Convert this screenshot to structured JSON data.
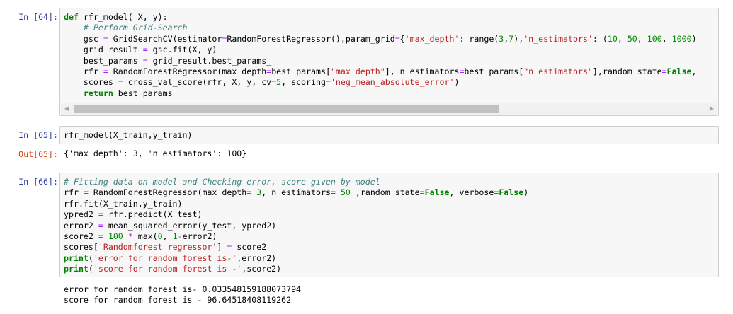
{
  "cells": [
    {
      "prompt": "In [64]:",
      "lines": [
        [
          {
            "t": "k",
            "v": "def"
          },
          {
            "t": "",
            "v": " rfr_model( X, y):"
          }
        ],
        [
          {
            "t": "",
            "v": "    "
          },
          {
            "t": "c",
            "v": "# Perform Grid-Search"
          }
        ],
        [
          {
            "t": "",
            "v": "    gsc "
          },
          {
            "t": "o",
            "v": "="
          },
          {
            "t": "",
            "v": " GridSearchCV(estimator"
          },
          {
            "t": "o",
            "v": "="
          },
          {
            "t": "",
            "v": "RandomForestRegressor(),param_grid"
          },
          {
            "t": "o",
            "v": "="
          },
          {
            "t": "",
            "v": "{"
          },
          {
            "t": "s",
            "v": "'max_depth'"
          },
          {
            "t": "",
            "v": ": range("
          },
          {
            "t": "n",
            "v": "3"
          },
          {
            "t": "",
            "v": ","
          },
          {
            "t": "n",
            "v": "7"
          },
          {
            "t": "",
            "v": "),"
          },
          {
            "t": "s",
            "v": "'n_estimators'"
          },
          {
            "t": "",
            "v": ": ("
          },
          {
            "t": "n",
            "v": "10"
          },
          {
            "t": "",
            "v": ", "
          },
          {
            "t": "n",
            "v": "50"
          },
          {
            "t": "",
            "v": ", "
          },
          {
            "t": "n",
            "v": "100"
          },
          {
            "t": "",
            "v": ", "
          },
          {
            "t": "n",
            "v": "1000"
          },
          {
            "t": "",
            "v": ")"
          }
        ],
        [
          {
            "t": "",
            "v": "    grid_result "
          },
          {
            "t": "o",
            "v": "="
          },
          {
            "t": "",
            "v": " gsc.fit(X, y)"
          }
        ],
        [
          {
            "t": "",
            "v": "    best_params "
          },
          {
            "t": "o",
            "v": "="
          },
          {
            "t": "",
            "v": " grid_result.best_params_"
          }
        ],
        [
          {
            "t": "",
            "v": "    rfr "
          },
          {
            "t": "o",
            "v": "="
          },
          {
            "t": "",
            "v": " RandomForestRegressor(max_depth"
          },
          {
            "t": "o",
            "v": "="
          },
          {
            "t": "",
            "v": "best_params["
          },
          {
            "t": "s",
            "v": "\"max_depth\""
          },
          {
            "t": "",
            "v": "], n_estimators"
          },
          {
            "t": "o",
            "v": "="
          },
          {
            "t": "",
            "v": "best_params["
          },
          {
            "t": "s",
            "v": "\"n_estimators\""
          },
          {
            "t": "",
            "v": "],random_state"
          },
          {
            "t": "o",
            "v": "="
          },
          {
            "t": "k",
            "v": "False"
          },
          {
            "t": "",
            "v": ","
          }
        ],
        [
          {
            "t": "",
            "v": "    scores "
          },
          {
            "t": "o",
            "v": "="
          },
          {
            "t": "",
            "v": " cross_val_score(rfr, X, y, cv"
          },
          {
            "t": "o",
            "v": "="
          },
          {
            "t": "n",
            "v": "5"
          },
          {
            "t": "",
            "v": ", scoring"
          },
          {
            "t": "o",
            "v": "="
          },
          {
            "t": "s",
            "v": "'neg_mean_absolute_error'"
          },
          {
            "t": "",
            "v": ")"
          }
        ],
        [
          {
            "t": "",
            "v": "    "
          },
          {
            "t": "k",
            "v": "return"
          },
          {
            "t": "",
            "v": " best_params"
          }
        ]
      ]
    },
    {
      "prompt": "In [65]:",
      "lines": [
        [
          {
            "t": "",
            "v": "rfr_model(X_train,y_train)"
          }
        ]
      ]
    },
    {
      "prompt": "In [66]:",
      "lines": [
        [
          {
            "t": "c",
            "v": "# Fitting data on model and Checking error, score given by model"
          }
        ],
        [
          {
            "t": "",
            "v": "rfr "
          },
          {
            "t": "o",
            "v": "="
          },
          {
            "t": "",
            "v": " RandomForestRegressor(max_depth"
          },
          {
            "t": "o",
            "v": "="
          },
          {
            "t": "",
            "v": " "
          },
          {
            "t": "n",
            "v": "3"
          },
          {
            "t": "",
            "v": ", n_estimators"
          },
          {
            "t": "o",
            "v": "="
          },
          {
            "t": "",
            "v": " "
          },
          {
            "t": "n",
            "v": "50"
          },
          {
            "t": "",
            "v": " ,random_state"
          },
          {
            "t": "o",
            "v": "="
          },
          {
            "t": "k",
            "v": "False"
          },
          {
            "t": "",
            "v": ", verbose"
          },
          {
            "t": "o",
            "v": "="
          },
          {
            "t": "k",
            "v": "False"
          },
          {
            "t": "",
            "v": ")"
          }
        ],
        [
          {
            "t": "",
            "v": "rfr.fit(X_train,y_train)"
          }
        ],
        [
          {
            "t": "",
            "v": "ypred2 "
          },
          {
            "t": "o",
            "v": "="
          },
          {
            "t": "",
            "v": " rfr.predict(X_test)"
          }
        ],
        [
          {
            "t": "",
            "v": "error2 "
          },
          {
            "t": "o",
            "v": "="
          },
          {
            "t": "",
            "v": " mean_squared_error(y_test, ypred2)"
          }
        ],
        [
          {
            "t": "",
            "v": "score2 "
          },
          {
            "t": "o",
            "v": "="
          },
          {
            "t": "",
            "v": " "
          },
          {
            "t": "n",
            "v": "100"
          },
          {
            "t": "",
            "v": " "
          },
          {
            "t": "o",
            "v": "*"
          },
          {
            "t": "",
            "v": " max("
          },
          {
            "t": "n",
            "v": "0"
          },
          {
            "t": "",
            "v": ", "
          },
          {
            "t": "n",
            "v": "1"
          },
          {
            "t": "o",
            "v": "-"
          },
          {
            "t": "",
            "v": "error2)"
          }
        ],
        [
          {
            "t": "",
            "v": "scores["
          },
          {
            "t": "s",
            "v": "'Randomforest regressor'"
          },
          {
            "t": "",
            "v": "] "
          },
          {
            "t": "o",
            "v": "="
          },
          {
            "t": "",
            "v": " score2"
          }
        ],
        [
          {
            "t": "k",
            "v": "print"
          },
          {
            "t": "",
            "v": "("
          },
          {
            "t": "s",
            "v": "'error for random forest is-'"
          },
          {
            "t": "",
            "v": ",error2)"
          }
        ],
        [
          {
            "t": "k",
            "v": "print"
          },
          {
            "t": "",
            "v": "("
          },
          {
            "t": "s",
            "v": "'score for random forest is -'"
          },
          {
            "t": "",
            "v": ",score2)"
          }
        ]
      ]
    }
  ],
  "out65": {
    "prompt": "Out[65]:",
    "text": "{'max_depth': 3, 'n_estimators': 100}"
  },
  "out66": {
    "line1": "error for random forest is- 0.033548159188073794",
    "line2": "score for random forest is - 96.64518408119262"
  },
  "scrollbar": {
    "left_arrow": "◀",
    "right_arrow": "▶"
  }
}
